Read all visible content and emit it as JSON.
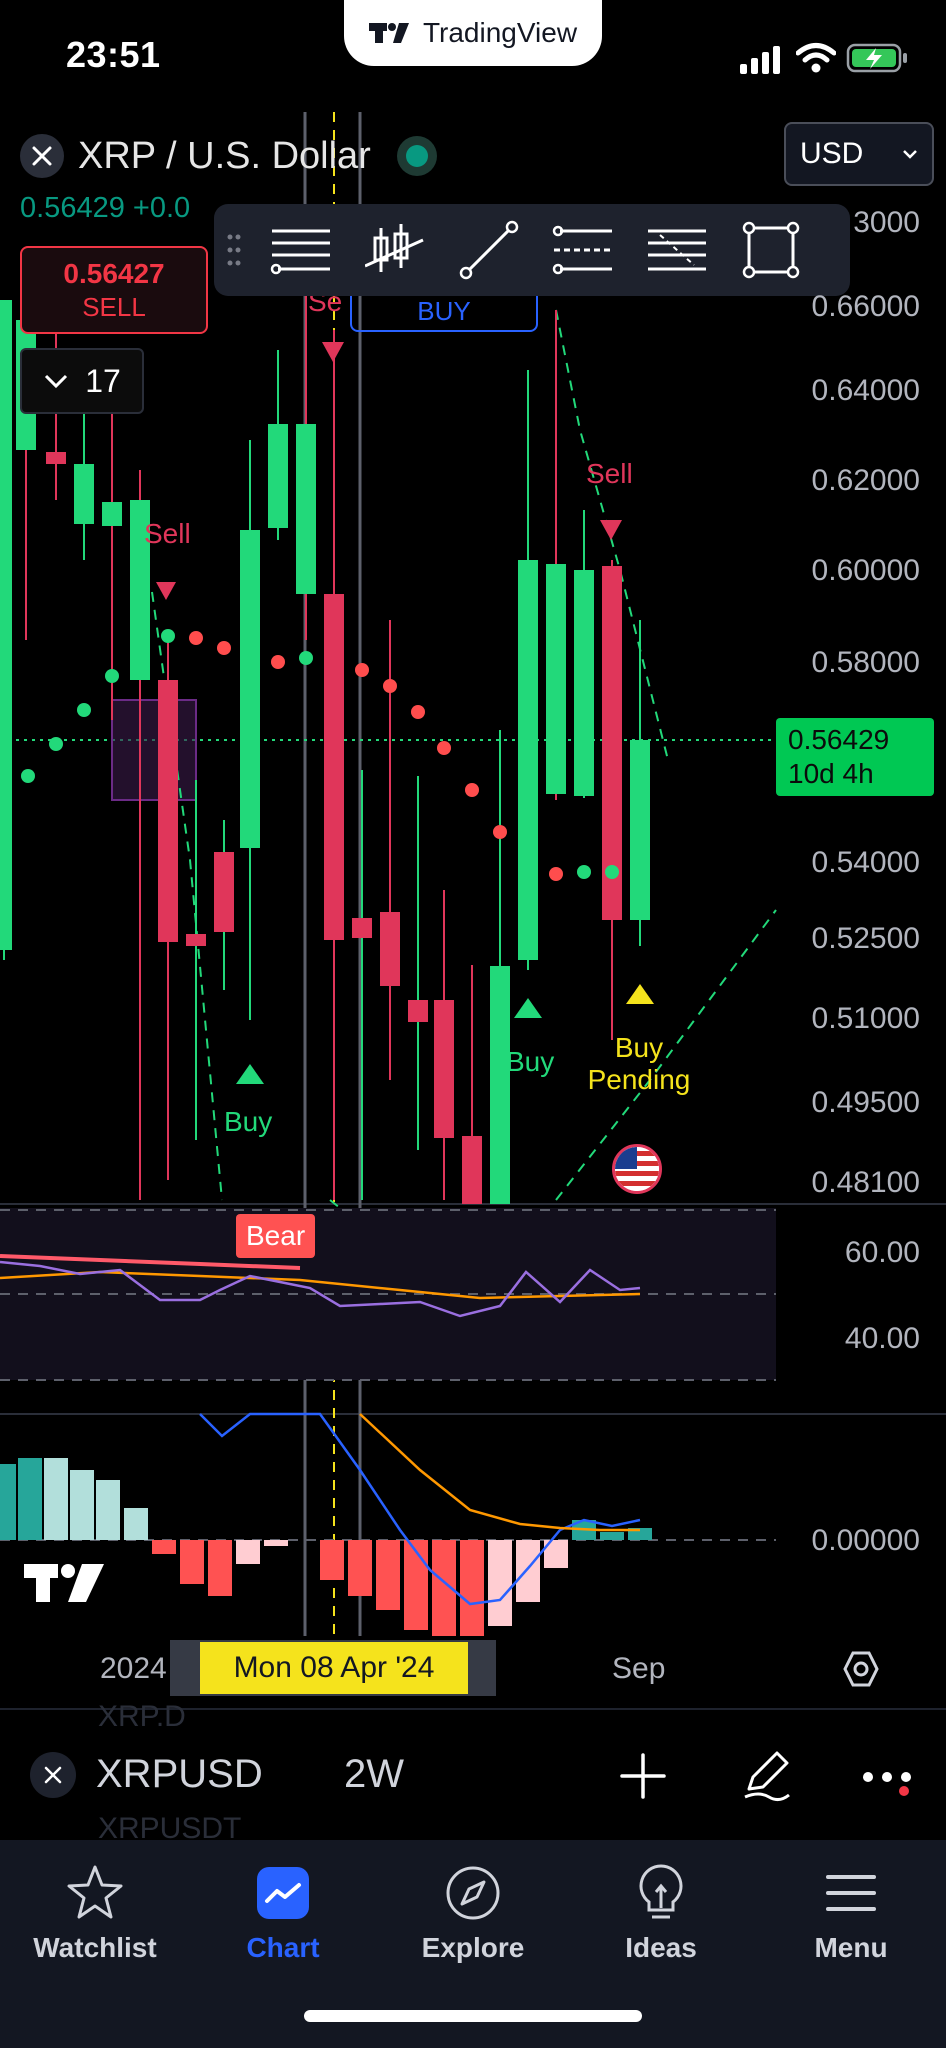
{
  "status_bar": {
    "time": "23:51"
  },
  "brand": {
    "name": "TradingView"
  },
  "header": {
    "symbol_title": "XRP / U.S. Dollar",
    "currency": "USD",
    "price_change": "0.56429 +0.0",
    "partial_price_label": "3000"
  },
  "order": {
    "sell_price": "0.56427",
    "sell_label": "SELL",
    "buy_label": "BUY"
  },
  "interval_box": {
    "value": "17"
  },
  "price_axis": [
    "0.66000",
    "0.64000",
    "0.62000",
    "0.60000",
    "0.58000",
    "0.54000",
    "0.52500",
    "0.51000",
    "0.49500",
    "0.48100"
  ],
  "last_price": {
    "value": "0.56429",
    "countdown": "10d 4h"
  },
  "signals": {
    "sell": "Sell",
    "buy": "Buy",
    "buy_pending_1": "Buy",
    "buy_pending_2": "Pending",
    "bear": "Bear"
  },
  "indicator_axis": {
    "rsi_high": "60.00",
    "rsi_low": "40.00",
    "macd_zero": "0.00000"
  },
  "time_axis": {
    "year": "2024",
    "crosshair_date": "Mon 08 Apr '24",
    "month": "Sep"
  },
  "bottom_bar": {
    "symbol": "XRPUSD",
    "interval": "2W",
    "ghost_above": "XRP.D",
    "ghost_below": "XRPUSDT"
  },
  "tabs": [
    {
      "label": "Watchlist",
      "icon": "star-icon"
    },
    {
      "label": "Chart",
      "icon": "chart-icon"
    },
    {
      "label": "Explore",
      "icon": "compass-icon"
    },
    {
      "label": "Ideas",
      "icon": "lightbulb-icon"
    },
    {
      "label": "Menu",
      "icon": "hamburger-icon"
    }
  ],
  "colors": {
    "bull": "#22d97a",
    "bear": "#e0365a",
    "accent": "#2962ff",
    "last_price_bg": "#00c853",
    "crosshair_label": "#f5e31c"
  }
}
